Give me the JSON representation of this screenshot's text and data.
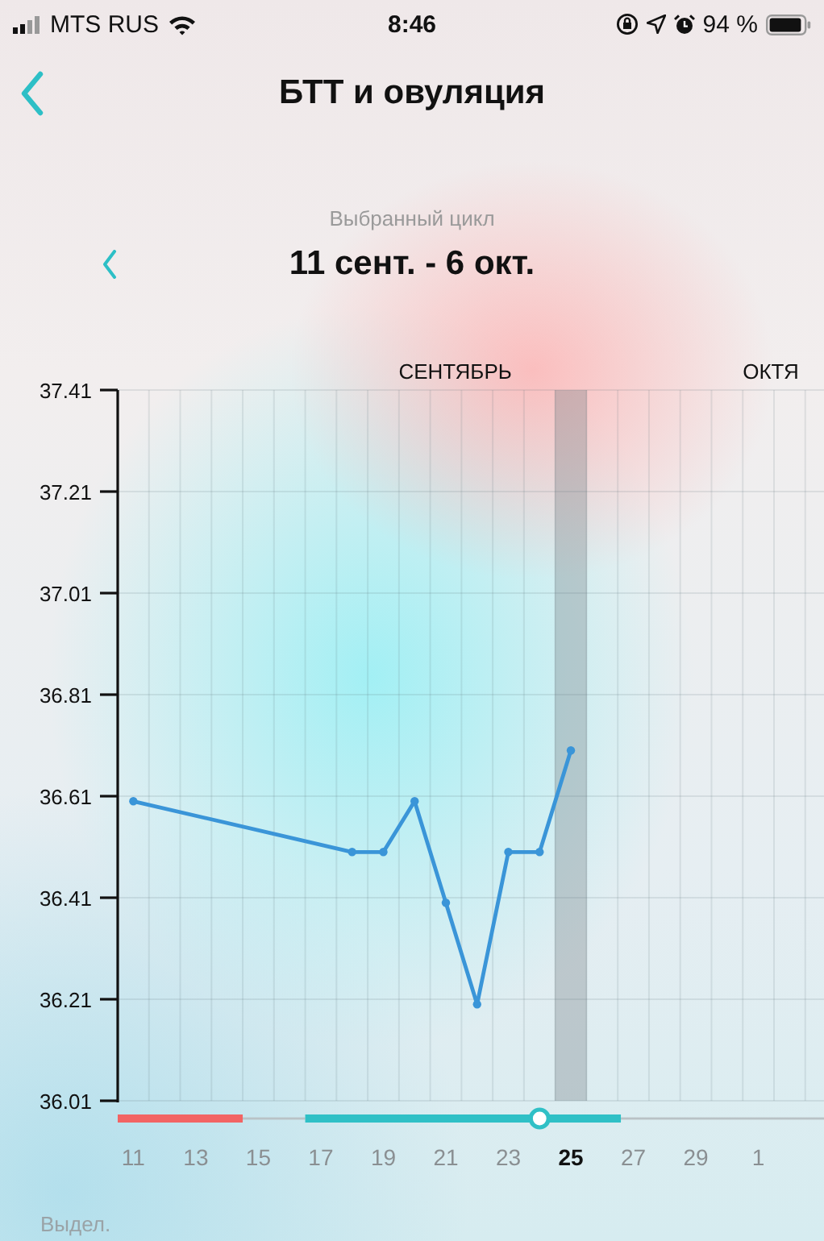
{
  "status_bar": {
    "carrier": "MTS RUS",
    "time": "8:46",
    "battery": "94 %"
  },
  "nav": {
    "title": "БТТ и овуляция"
  },
  "cycle": {
    "caption": "Выбранный цикл",
    "range": "11 сент. - 6 окт."
  },
  "chart": {
    "months": [
      {
        "label": "СЕНТЯБРЬ"
      },
      {
        "label": "ОКТЯ"
      }
    ],
    "chart_data": {
      "type": "line",
      "grid": true,
      "x": [
        11,
        18,
        19,
        20,
        21,
        22,
        23,
        24,
        25
      ],
      "series": [
        {
          "color": "#3a95d8",
          "marker": true,
          "values": [
            36.6,
            36.5,
            36.5,
            36.6,
            36.4,
            36.2,
            36.5,
            36.5,
            36.7
          ]
        }
      ],
      "xlim": [
        10.5,
        33.1
      ],
      "ylim": [
        36.01,
        37.41
      ],
      "xticks": [
        11,
        13,
        15,
        17,
        19,
        21,
        23,
        25,
        27,
        29
      ],
      "yticks": [
        36.01,
        36.21,
        36.41,
        36.61,
        36.81,
        37.01,
        37.21,
        37.41
      ]
    },
    "next_month_label": "1",
    "tick_states": [
      {
        "selected": false
      },
      {
        "selected": false
      },
      {
        "selected": false
      },
      {
        "selected": false
      },
      {
        "selected": false
      },
      {
        "selected": false
      },
      {
        "selected": false
      },
      {
        "selected": true
      },
      {
        "selected": false
      },
      {
        "selected": false
      },
      {
        "selected": false
      }
    ],
    "timeline": {
      "segments": [
        {
          "color": "#f26464"
        },
        {
          "color": "#2fc0c6"
        }
      ]
    }
  },
  "footer": {
    "label": "Выдел."
  }
}
